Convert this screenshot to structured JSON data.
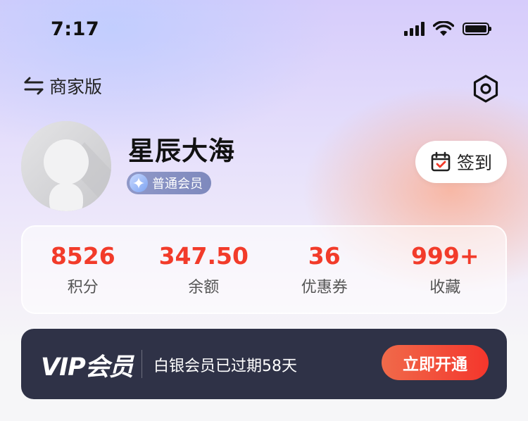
{
  "status_bar": {
    "time": "7:17",
    "icons": [
      "signal-icon",
      "wifi-icon",
      "battery-icon"
    ]
  },
  "header": {
    "switch_label": "商家版",
    "switch_icon": "swap-arrows-icon",
    "settings_icon": "hexagon-settings-icon"
  },
  "profile": {
    "username": "星辰大海",
    "member_level": "普通会员",
    "avatar_icon": "default-avatar-icon"
  },
  "checkin": {
    "label": "签到",
    "icon": "calendar-check-icon"
  },
  "stats": [
    {
      "value": "8526",
      "label": "积分"
    },
    {
      "value": "347.50",
      "label": "余额"
    },
    {
      "value": "36",
      "label": "优惠券"
    },
    {
      "value": "999+",
      "label": "收藏"
    }
  ],
  "vip": {
    "title": "VIP会员",
    "status": "白银会员已过期58天",
    "button_label": "立即开通"
  },
  "colors": {
    "accent_red": "#f23b2a",
    "vip_bg": "#2f3247",
    "vip_button": "#f4362c"
  }
}
